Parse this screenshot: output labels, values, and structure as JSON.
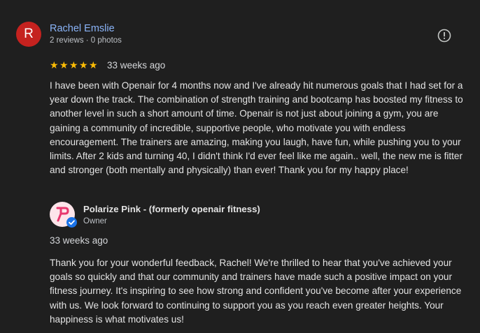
{
  "review": {
    "avatar_letter": "R",
    "avatar_color": "#c5221f",
    "reviewer_name": "Rachel Emslie",
    "reviewer_meta": "2 reviews · 0 photos",
    "rating": 5,
    "rating_max": 5,
    "star_glyph": "★",
    "date": "33 weeks ago",
    "text": "I have been with Openair for 4 months now and I've already hit numerous goals that I had set for a year down the track. The combination of strength training and bootcamp has boosted my fitness to another level in such a short amount of time. Openair is not just about joining a gym, you are gaining a community of incredible, supportive people, who motivate you with endless encouragement. The trainers are amazing, making you laugh, have fun, while pushing you to your limits. After 2 kids and turning 40, I didn't think I'd ever feel like me again.. well, the new me is fitter and stronger (both mentally and physically) than ever! Thank you for my happy place!",
    "report_icon": "report-icon"
  },
  "owner_response": {
    "owner_name": "Polarize Pink - (formerly openair fitness)",
    "owner_role": "Owner",
    "logo_icon": "polarize-pink-logo",
    "badge_icon": "verified-badge-icon",
    "date": "33 weeks ago",
    "text": "Thank you for your wonderful feedback, Rachel! We're thrilled to hear that you've achieved your goals so quickly and that our community and trainers have made such a positive impact on your fitness journey. It's inspiring to see how strong and confident you've become after your experience with us. We look forward to continuing to support you as you reach even greater heights. Your happiness is what motivates us!"
  },
  "colors": {
    "background": "#1f1f1f",
    "link_blue": "#8ab4f8",
    "star_yellow": "#fbbc04",
    "brand_pink": "#e8386e",
    "verified_blue": "#1a73e8"
  }
}
